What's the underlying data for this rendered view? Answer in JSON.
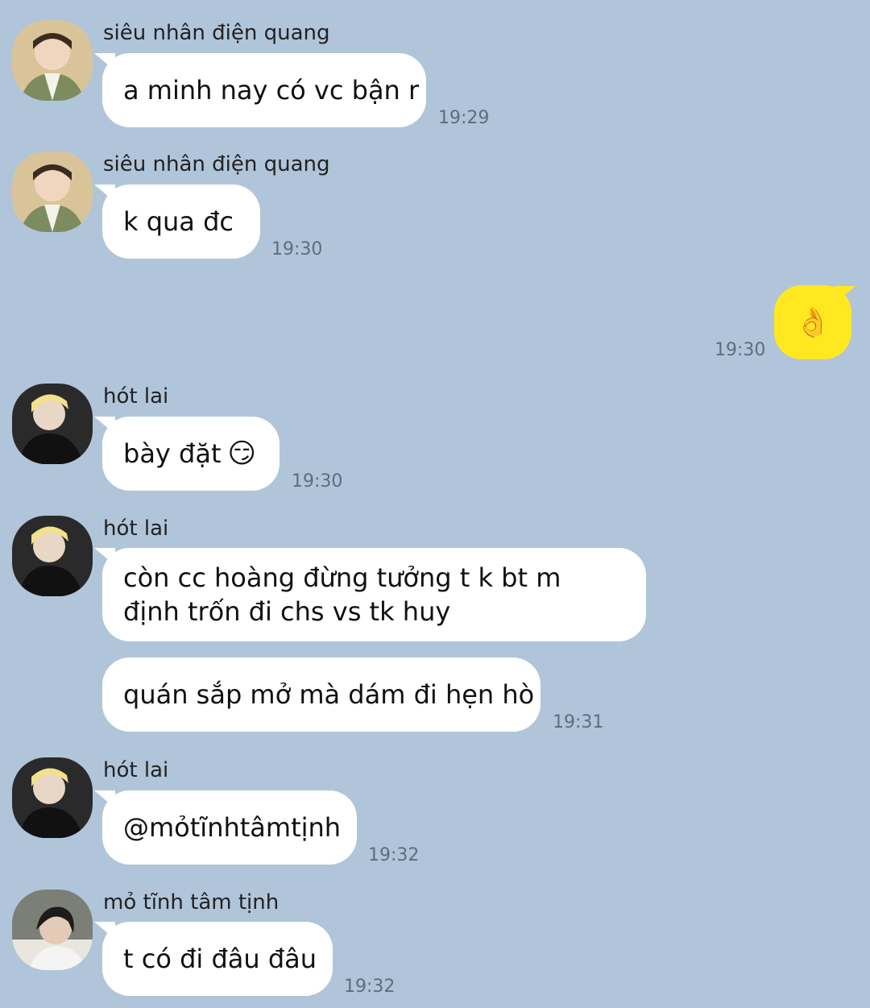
{
  "messages": [
    {
      "sender": "siêu nhân điện quang",
      "text": "a minh nay có vc bận r",
      "time": "19:29"
    },
    {
      "sender": "siêu nhân điện quang",
      "text": "k qua đc",
      "time": "19:30"
    },
    {
      "sender": "me",
      "emoji": "👌",
      "time": "19:30"
    },
    {
      "sender": "hót lai",
      "text": "bày đặt",
      "emoji": "😏",
      "time": "19:30"
    },
    {
      "sender": "hót lai",
      "text": "còn cc hoàng đừng tưởng t k bt m định trốn đi chs vs tk huy"
    },
    {
      "text": "quán sắp mở mà dám đi hẹn hò",
      "time": "19:31"
    },
    {
      "sender": "hót lai",
      "text": "@mỏtĩnhtâmtịnh",
      "time": "19:32"
    },
    {
      "sender": "mỏ tĩnh tâm tịnh",
      "text": "t có đi đâu đâu",
      "time": "19:32"
    }
  ],
  "colors": {
    "background": "#b0c5da",
    "incoming_bubble": "#ffffff",
    "outgoing_bubble": "#ffe81f"
  }
}
